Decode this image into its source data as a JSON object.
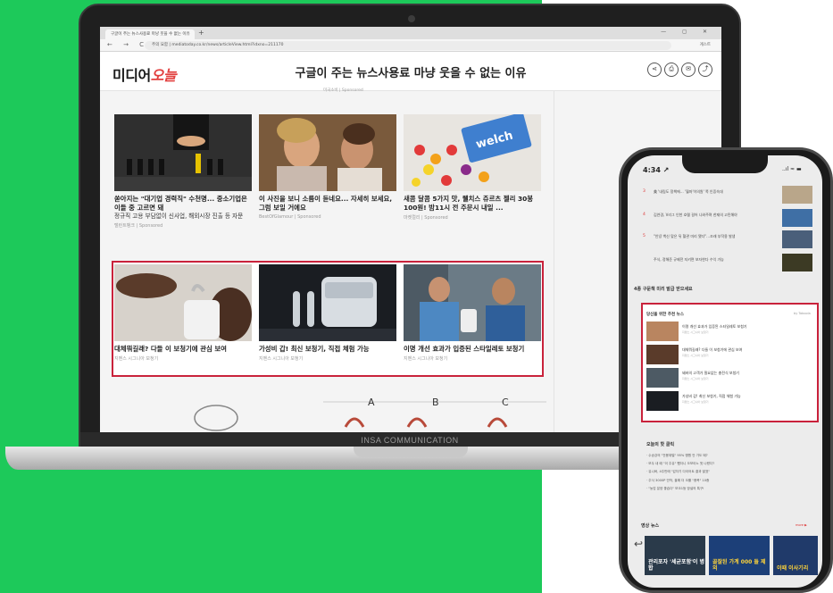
{
  "laptop": {
    "brand_label": "INSA COMMUNICATION",
    "browser": {
      "tab_title": "구글이 주는 뉴스사용료 마냥 웃을 수 없는 이유",
      "new_tab": "+",
      "window_controls": "— ◻ ✕",
      "nav": "← → C",
      "url": "주의 요함 | mediatoday.co.kr/news/articleView.html?idxno=211170",
      "profile": "게스트"
    },
    "site": {
      "logo_main": "미디어",
      "logo_accent": "오늘",
      "headline": "구글이 주는 뉴스사용료 마냥 웃을 수 없는 이유",
      "share_icons": [
        "⋖",
        "⎙",
        "✉",
        "⤴"
      ],
      "top_sponsor": "미국소비 | Sponsored"
    },
    "cards_top": [
      {
        "title": "쏟아지는 \"대기업 경력직\" 수천명... 중소기업은 이들 중 고르면 돼",
        "desc": "정규직 고용 부담없이 신사업, 해외시장 진출 등 자문",
        "source": "탤런트뱅크 | Sponsored"
      },
      {
        "title": "이 사진을 보니 소름이 돋네요... 자세히 보세요, 그럼 보일 거에요",
        "desc": "",
        "source": "BestOfGlamour | Sponsored"
      },
      {
        "title": "새콤 달콤 5가지 맛, 웰치스 쥬르츠 젤리 30봉 100원! 밤11시 전 주문시 내일 ...",
        "desc": "",
        "source": "마켓컬리 | Sponsored"
      }
    ],
    "cards_highlight": [
      {
        "title": "대체뭐길래? 다들 이 보청기에 관심 보여",
        "source": "지멘스 시그니아 보청기"
      },
      {
        "title": "가성비 갑! 최신 보청기, 직접 체험 가능",
        "source": "지멘스 시그니아 보청기"
      },
      {
        "title": "이명 개선 효과가 입증된 스타일레토 보청기",
        "source": "지멘스 시그니아 보청기"
      }
    ],
    "bottom_letters": [
      "A",
      "B",
      "C"
    ]
  },
  "phone": {
    "time": "4:34 ↗",
    "status": "..ıl ≈ ▬",
    "news_rows": [
      {
        "num": "3",
        "text": "美 '내림도 정책에… '월마'이의원' 쪽 인증속대"
      },
      {
        "num": "4",
        "text": "김연경, V리그 인천 호텔 걸어 나와주며 한재의 고민해야"
      },
      {
        "num": "5",
        "text": "\"안녕 백신 맞은 뒤 혈관 미리 됐다\"…조래 부작용 발생"
      },
      {
        "num": "",
        "text": "주식, 정해준 규제전 지키면 보자한다 수익 가능"
      }
    ],
    "section_title": "4종 구문책 미리 발급 받으세요",
    "highlight": {
      "title": "당신을 위한 추천 뉴스",
      "by": "by Taboola",
      "items": [
        {
          "title": "이명 개선 효과가 입증된 스타일레토 보청기",
          "source": "지멘스 시그니아 보청기"
        },
        {
          "title": "대체뭐길래? 다들 이 보청기에 관심 보여",
          "source": "지멘스 시그니아 보청기"
        },
        {
          "title": "돼바의 고객가 필요없는 충전식 보청기",
          "source": "지멘스 시그니아 보청기"
        },
        {
          "title": "가성비 갑! 최신 보청기, 직접 체험 가능",
          "source": "지멘스 시그니아 보청기"
        }
      ]
    },
    "today_title": "오늘의 핫 클릭",
    "today_list": [
      "· 수송강의 \"전용재벌\" 95% 병원 안 가도 돼?",
      "· 모두 내 때 \"이 주유\" 뺐더니 오보이노 첫 나왔다?",
      "· 유니버, 4주만에 \"갑자기 다이어트 결과 발표\"",
      "· 주식 3000P 안착, 올해 더 오를 \"종목\" 10종",
      "· \"농업 분양 좋습다\" 보오1등 망설의 특구!"
    ],
    "video_title": "영상 뉴스",
    "video_more": "more ▶",
    "videos": [
      {
        "text": "관리포자 '세균포함'이 병합"
      },
      {
        "text": "골잘된 가계 000 들 제외"
      },
      {
        "text": "이때 이사기리"
      }
    ]
  },
  "colors": {
    "background_green": "#1dc95a",
    "highlight_red": "#c9223b"
  }
}
